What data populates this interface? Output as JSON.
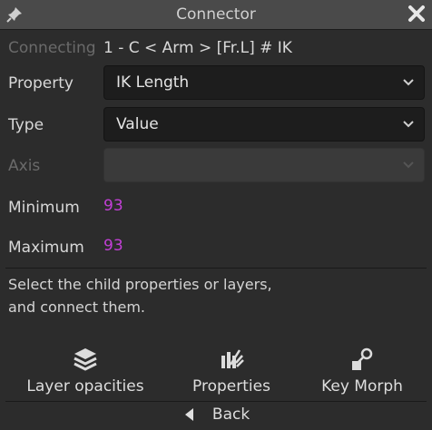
{
  "window": {
    "title": "Connector"
  },
  "connecting": {
    "label": "Connecting",
    "value": "1 - C < Arm > [Fr.L] # IK"
  },
  "property": {
    "label": "Property",
    "value": "IK Length"
  },
  "type": {
    "label": "Type",
    "value": "Value"
  },
  "axis": {
    "label": "Axis",
    "value": ""
  },
  "minimum": {
    "label": "Minimum",
    "value": "93"
  },
  "maximum": {
    "label": "Maximum",
    "value": "93"
  },
  "help": {
    "line1": "Select the child properties or layers,",
    "line2": "and connect them."
  },
  "buttons": {
    "layer_opacities": "Layer opacities",
    "properties": "Properties",
    "key_morph": "Key Morph",
    "back": "Back"
  },
  "colors": {
    "accent_value": "#c23fd6",
    "background": "#2c2c2c",
    "titlebar": "#4a4a4a"
  }
}
